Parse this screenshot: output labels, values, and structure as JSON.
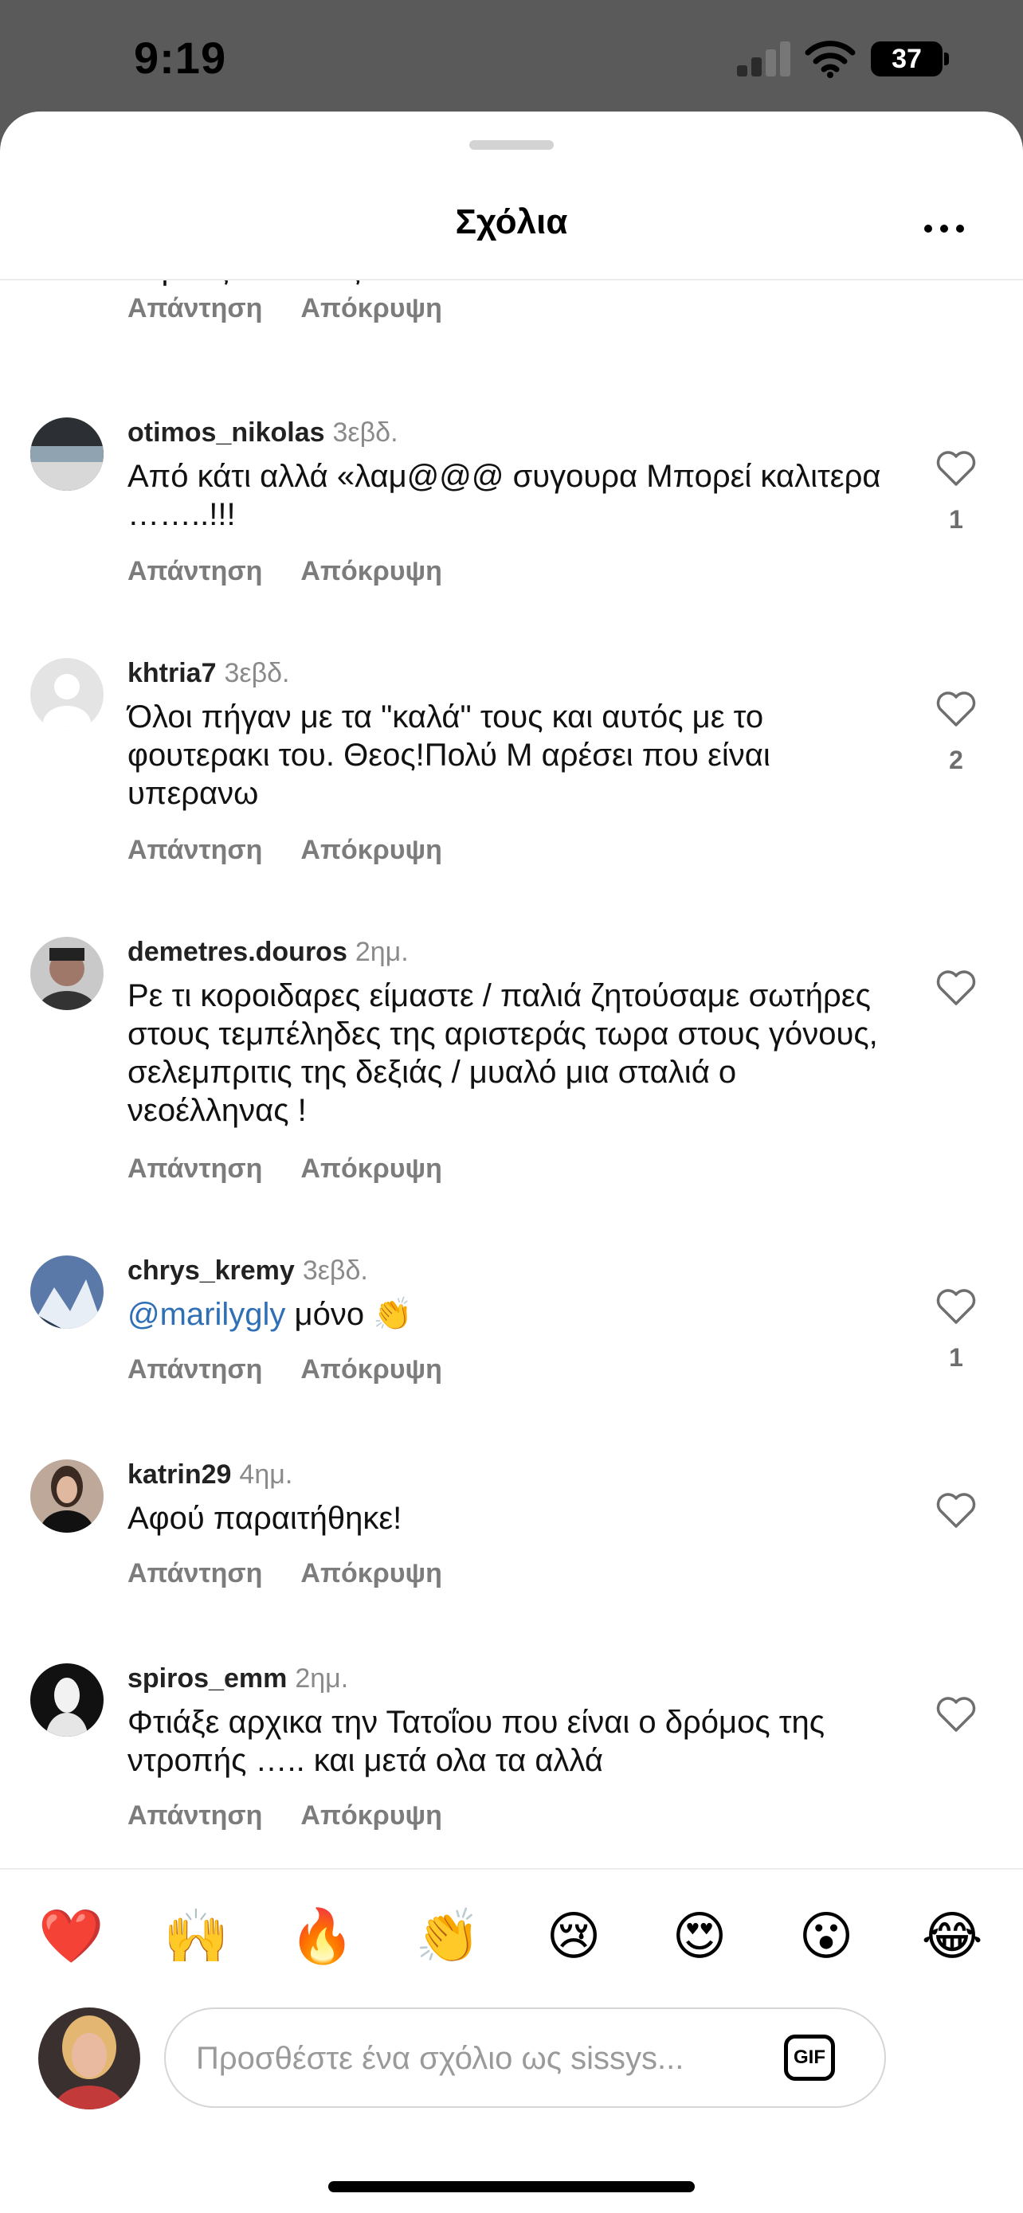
{
  "status": {
    "time": "9:19",
    "battery": "37"
  },
  "header": {
    "title": "Σχόλια"
  },
  "partial_comment": {
    "text": "σεμνός ταπεινός"
  },
  "action_labels": {
    "reply": "Απάντηση",
    "hide": "Απόκρυψη"
  },
  "comments": [
    {
      "username": "otimos_nikolas",
      "time": "3εβδ.",
      "text": "Από κάτι αλλά «λαμ@@@ συγουρα Μπορεί καλιτερα ……..!!!",
      "likes": "1"
    },
    {
      "username": "khtria7",
      "time": "3εβδ.",
      "text": "Όλοι πήγαν με τα \"καλά\" τους και αυτός με το φουτερακι του. Θεος!Πολύ Μ αρέσει που είναι υπερανω",
      "likes": "2"
    },
    {
      "username": "demetres.douros",
      "time": "2ημ.",
      "text": "Ρε τι κοροιδαρες είμαστε / παλιά ζητούσαμε σωτήρες στους τεμπέληδες  της αριστεράς τωρα στους γόνους, σελεμπριτις της δεξιάς / μυαλό μια σταλιά ο νεοέλληνας !",
      "likes": ""
    },
    {
      "username": "chrys_kremy",
      "time": "3εβδ.",
      "mention": "@marilygly",
      "text": " μόνο 👏",
      "likes": "1"
    },
    {
      "username": "katrin29",
      "time": "4ημ.",
      "text": "Αφού παραιτήθηκε!",
      "likes": ""
    },
    {
      "username": "spiros_emm",
      "time": "2ημ.",
      "text": "Φτιάξε αρχικα την Τατοΐου που είναι ο δρόμος της ντροπής ….. και μετά ολα τα αλλά",
      "likes": ""
    }
  ],
  "emojis": [
    "❤️",
    "🙌",
    "🔥",
    "👏",
    "😢",
    "😍",
    "😮",
    "😂"
  ],
  "composer": {
    "placeholder": "Προσθέστε ένα σχόλιο ως sissys...",
    "gif_label": "GIF"
  },
  "colors": {
    "mention": "#2f6fb5",
    "meta_gray": "#8a8a8a"
  }
}
